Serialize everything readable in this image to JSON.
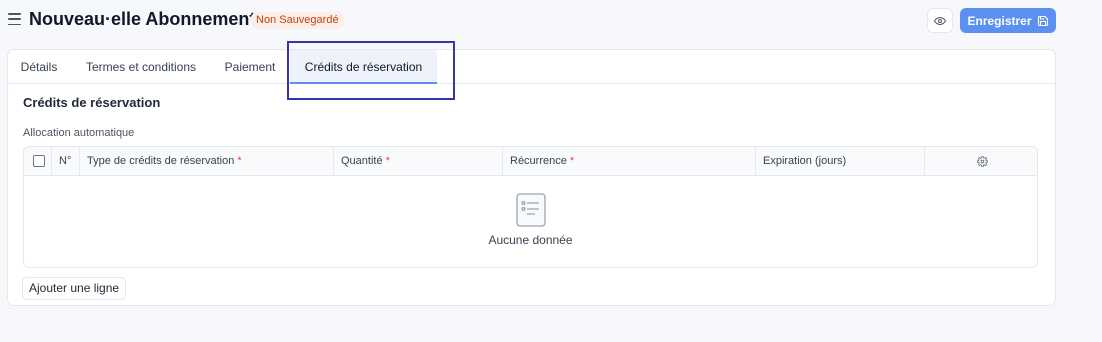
{
  "header": {
    "title": "Nouveau·elle Abonnement",
    "status_badge": "Non Sauvegardé",
    "save_label": "Enregistrer"
  },
  "tabs": [
    {
      "label": "Détails",
      "active": false
    },
    {
      "label": "Termes et conditions",
      "active": false
    },
    {
      "label": "Paiement",
      "active": false
    },
    {
      "label": "Crédits de réservation",
      "active": true
    }
  ],
  "section": {
    "title": "Crédits de réservation",
    "field_label": "Allocation automatique"
  },
  "table": {
    "columns": [
      {
        "label": "N°",
        "required": false
      },
      {
        "label": "Type de crédits de réservation",
        "required": true
      },
      {
        "label": "Quantité",
        "required": true
      },
      {
        "label": "Récurrence",
        "required": true
      },
      {
        "label": "Expiration (jours)",
        "required": false
      }
    ],
    "required_marker": "*",
    "empty_text": "Aucune donnée",
    "add_row_label": "Ajouter une ligne"
  },
  "colors": {
    "accent": "#5b8ff0",
    "badge_bg": "#fdeee8",
    "badge_text": "#c2410c",
    "focus_outline": "#3338a8"
  },
  "icons": [
    "menu-icon",
    "eye-icon",
    "save-icon",
    "settings-gear-icon",
    "empty-list-icon"
  ]
}
